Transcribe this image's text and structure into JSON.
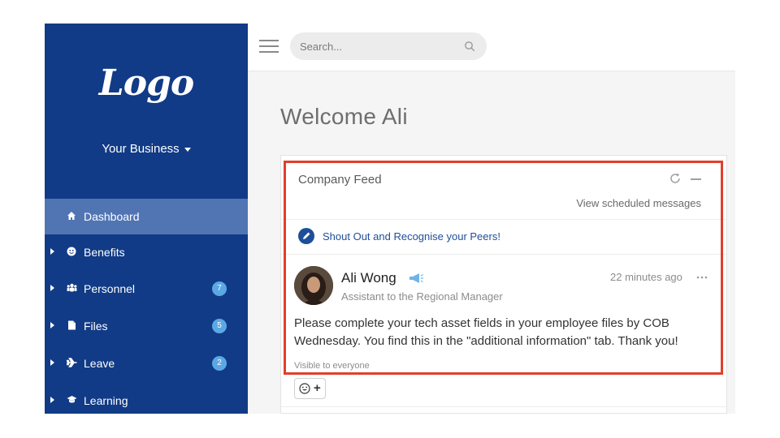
{
  "sidebar": {
    "logo": "Logo",
    "business": "Your Business",
    "items": [
      {
        "label": "Dashboard",
        "icon": "home-icon",
        "active": true,
        "badge": ""
      },
      {
        "label": "Benefits",
        "icon": "smiley-icon",
        "active": false,
        "badge": ""
      },
      {
        "label": "Personnel",
        "icon": "people-icon",
        "active": false,
        "badge": "7"
      },
      {
        "label": "Files",
        "icon": "file-icon",
        "active": false,
        "badge": "5"
      },
      {
        "label": "Leave",
        "icon": "plane-icon",
        "active": false,
        "badge": "2"
      },
      {
        "label": "Learning",
        "icon": "graduation-cap-icon",
        "active": false,
        "badge": ""
      }
    ]
  },
  "search": {
    "placeholder": "Search..."
  },
  "main": {
    "welcome": "Welcome Ali"
  },
  "feed": {
    "title": "Company Feed",
    "scheduled_link": "View scheduled messages",
    "shout_out": "Shout Out and Recognise your Peers!",
    "post": {
      "author": "Ali Wong",
      "role": "Assistant to the Regional Manager",
      "time": "22 minutes ago",
      "body": "Please complete your tech asset fields in your employee files by COB Wednesday. You find this in the \"additional information\" tab. Thank you!",
      "visibility": "Visible to everyone",
      "reaction_plus": "+"
    }
  },
  "colors": {
    "sidebar": "#113b86",
    "sidebar_active": "#5175b3",
    "badge": "#5ba8e4",
    "link": "#1f4e99",
    "highlight": "#e0402a"
  }
}
